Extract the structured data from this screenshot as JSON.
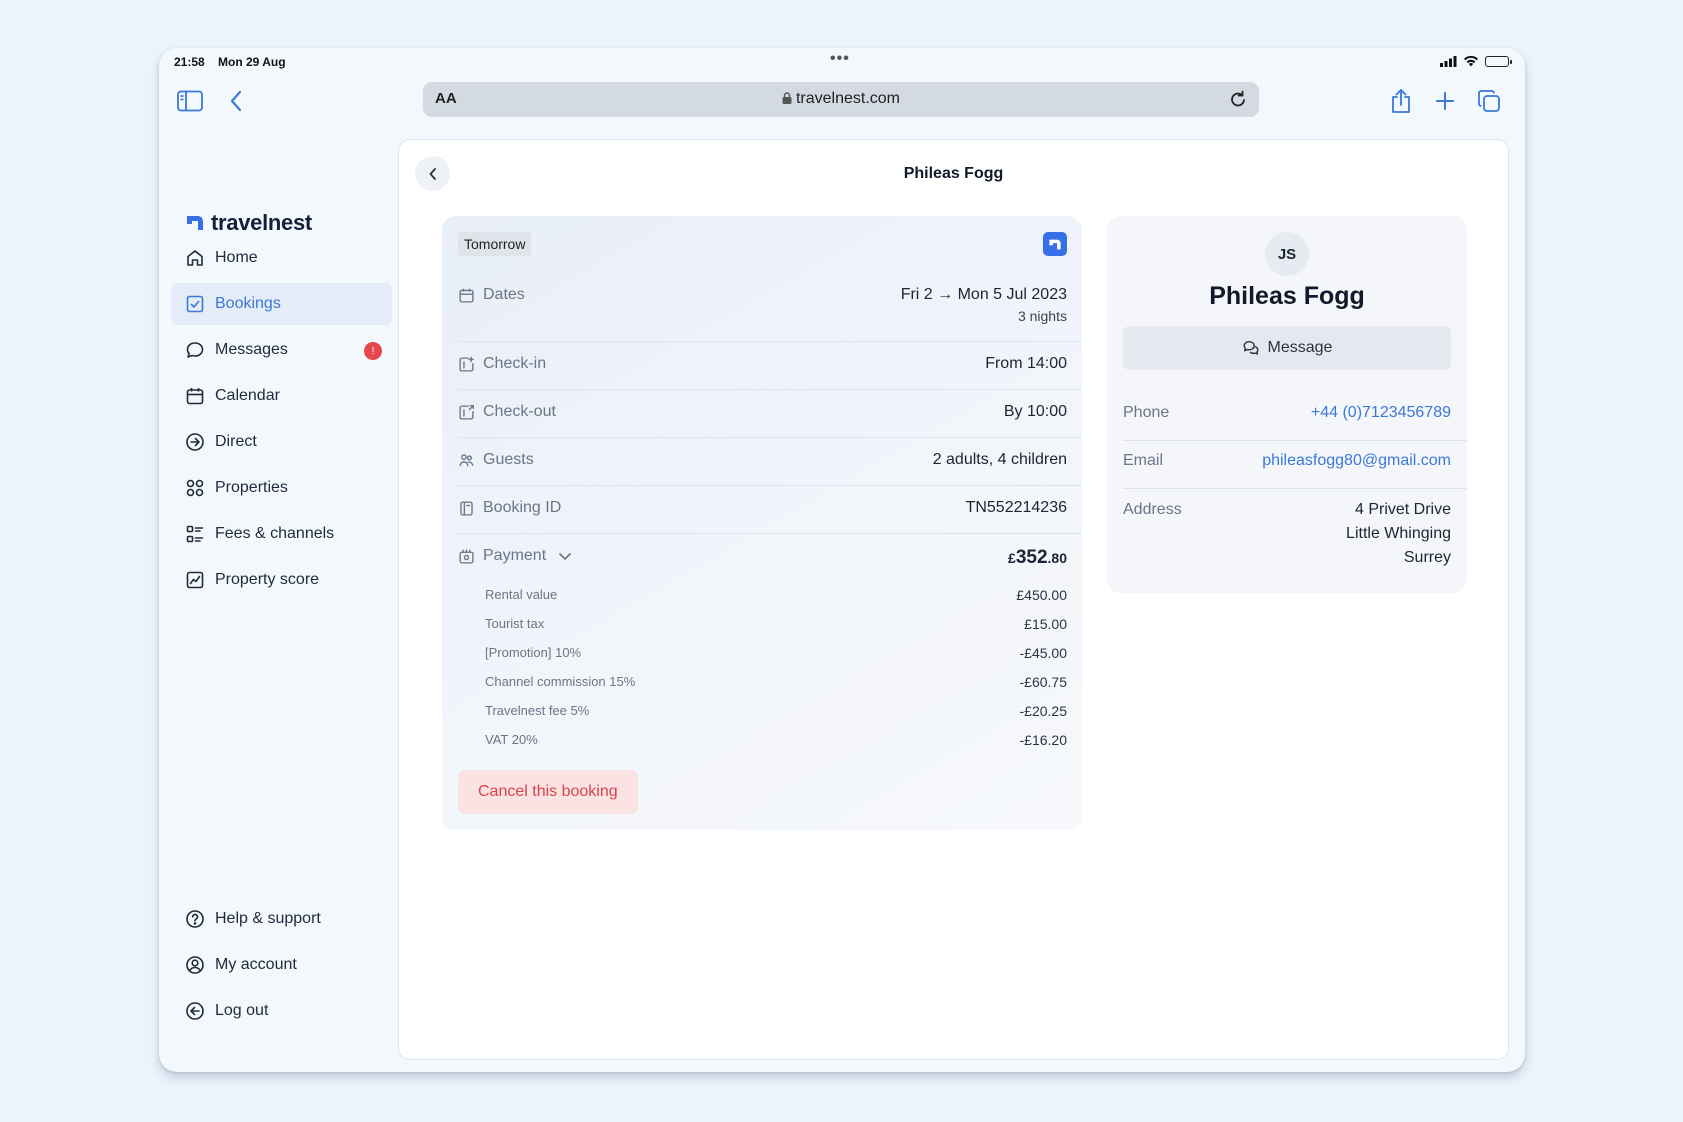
{
  "status": {
    "time": "21:58",
    "date": "Mon 29 Aug",
    "dots": "•••"
  },
  "browser": {
    "aa": "AA",
    "url": "travelnest.com"
  },
  "brand": {
    "name": "travelnest"
  },
  "nav": {
    "home": "Home",
    "bookings": "Bookings",
    "messages": "Messages",
    "messages_badge": "!",
    "calendar": "Calendar",
    "direct": "Direct",
    "properties": "Properties",
    "fees": "Fees & channels",
    "score": "Property score",
    "help": "Help & support",
    "account": "My account",
    "logout": "Log out"
  },
  "page": {
    "title": "Phileas Fogg"
  },
  "booking": {
    "tag": "Tomorrow",
    "dates_label": "Dates",
    "dates_value": "Fri 2 → Mon 5 Jul 2023",
    "nights": "3 nights",
    "checkin_label": "Check-in",
    "checkin_value": "From 14:00",
    "checkout_label": "Check-out",
    "checkout_value": "By 10:00",
    "guests_label": "Guests",
    "guests_value": "2 adults, 4 children",
    "id_label": "Booking ID",
    "id_value": "TN552214236",
    "payment_label": "Payment",
    "payment_currency": "£",
    "payment_main": "352",
    "payment_cents": ".80",
    "items": [
      {
        "label": "Rental value",
        "amount": "£450.00"
      },
      {
        "label": "Tourist tax",
        "amount": "£15.00"
      },
      {
        "label": "[Promotion] 10%",
        "amount": "-£45.00"
      },
      {
        "label": "Channel commission 15%",
        "amount": "-£60.75"
      },
      {
        "label": "Travelnest fee 5%",
        "amount": "-£20.25"
      },
      {
        "label": "VAT 20%",
        "amount": "-£16.20"
      }
    ],
    "cancel": "Cancel this booking"
  },
  "guest": {
    "initials": "JS",
    "name": "Phileas Fogg",
    "message": "Message",
    "phone_label": "Phone",
    "phone": "+44 (0)7123456789",
    "email_label": "Email",
    "email": "phileasfogg80@gmail.com",
    "address_label": "Address",
    "address": [
      "4 Privet Drive",
      "Little Whinging",
      "Surrey"
    ]
  },
  "colors": {
    "accent": "#3b78d8",
    "danger": "#d8424a",
    "badge": "#e5484d",
    "brand": "#3770e6"
  }
}
